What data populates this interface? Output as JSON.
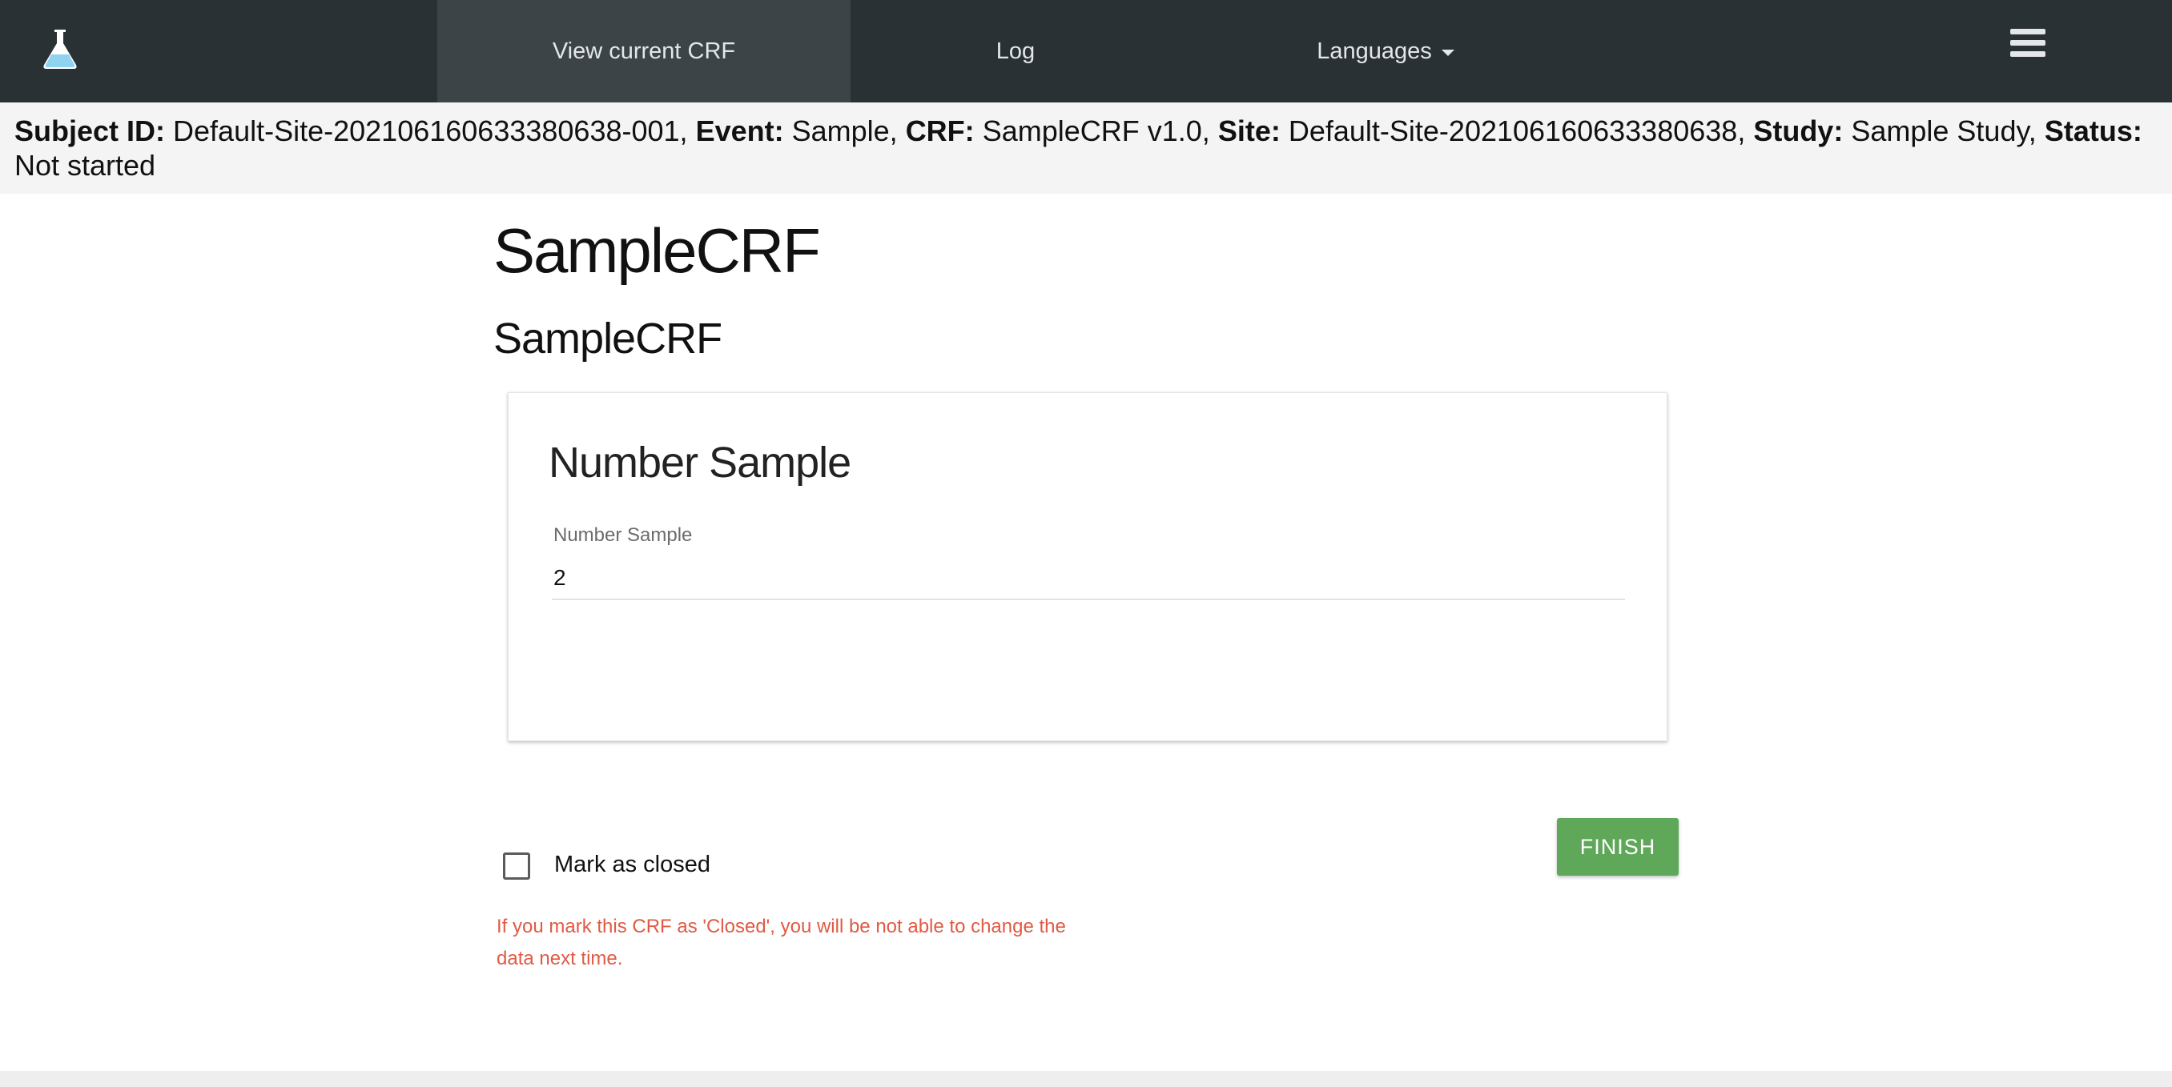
{
  "nav": {
    "logo_icon": "flask-icon",
    "items": [
      {
        "label": "View current CRF",
        "active": true
      },
      {
        "label": "Log",
        "active": false
      },
      {
        "label": "Languages",
        "active": false
      }
    ],
    "menu_icon": "hamburger-menu-icon"
  },
  "info": {
    "subject_id_label": "Subject ID:",
    "subject_id": "Default-Site-202106160633380638-001",
    "event_label": "Event:",
    "event": "Sample",
    "crf_label": "CRF:",
    "crf": "SampleCRF v1.0",
    "site_label": "Site:",
    "site": "Default-Site-202106160633380638",
    "study_label": "Study:",
    "study": "Sample Study",
    "status_label": "Status:",
    "status": "Not started"
  },
  "form": {
    "title": "SampleCRF",
    "subtitle": "SampleCRF",
    "card_title": "Number Sample",
    "field_label": "Number Sample",
    "field_value": "2"
  },
  "footer_controls": {
    "checkbox_label": "Mark as closed",
    "checkbox_checked": false,
    "warning": "If you mark this CRF as 'Closed', you will be not able to change the data next time.",
    "finish_label": "FINISH"
  },
  "colors": {
    "navbar": "#2a3135",
    "active_tab": "#3c4448",
    "finish_button": "#5fa85a",
    "warning_text": "#e05a45"
  }
}
